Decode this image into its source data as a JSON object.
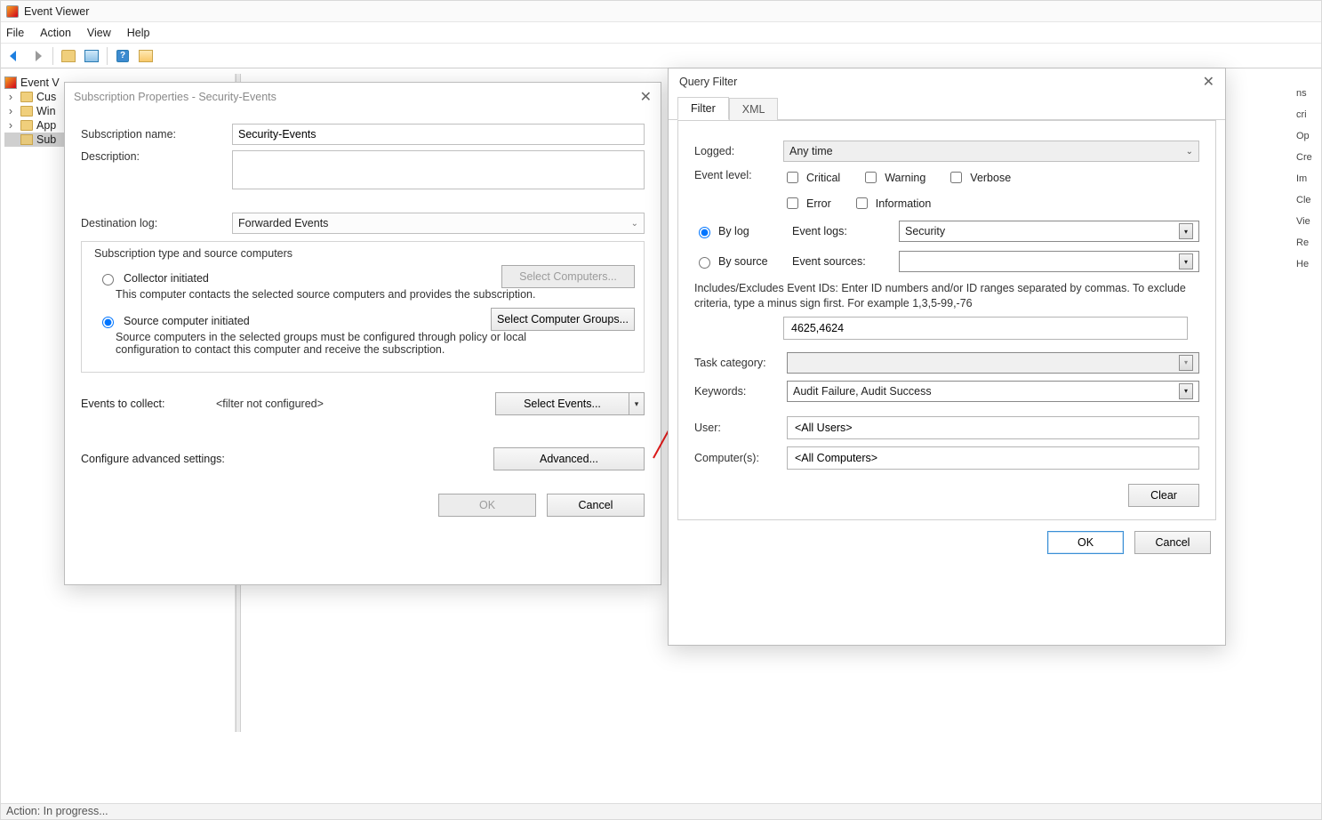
{
  "app": {
    "title": "Event Viewer"
  },
  "menu": {
    "file": "File",
    "action": "Action",
    "view": "View",
    "help": "Help"
  },
  "tree": {
    "root": "Event V",
    "items": [
      "Cus",
      "Win",
      "App",
      "Sub"
    ]
  },
  "status": "Action:  In progress...",
  "subProps": {
    "title": "Subscription Properties - Security-Events",
    "subNameLbl": "Subscription name:",
    "subName": "Security-Events",
    "descLbl": "Description:",
    "descVal": "",
    "destLogLbl": "Destination log:",
    "destLog": "Forwarded Events",
    "groupTitle": "Subscription type and source computers",
    "collectorLbl": "Collector initiated",
    "collectorHelp": "This computer contacts the selected source computers and provides the subscription.",
    "selectComputersBtn": "Select Computers...",
    "sourceLbl": "Source computer initiated",
    "sourceHelp": "Source computers in the selected groups must be configured through policy or local configuration to contact this computer and receive the subscription.",
    "selectGroupsBtn": "Select Computer Groups...",
    "eventsCollectLbl": "Events to collect:",
    "filterText": "<filter not configured>",
    "selectEventsBtn": "Select Events...",
    "cfgAdvLbl": "Configure advanced settings:",
    "advancedBtn": "Advanced...",
    "okBtn": "OK",
    "cancelBtn": "Cancel"
  },
  "qf": {
    "title": "Query Filter",
    "tabFilter": "Filter",
    "tabXml": "XML",
    "loggedLbl": "Logged:",
    "loggedVal": "Any time",
    "levelLbl": "Event level:",
    "lvCritical": "Critical",
    "lvWarning": "Warning",
    "lvVerbose": "Verbose",
    "lvError": "Error",
    "lvInfo": "Information",
    "byLog": "By log",
    "evLogsLbl": "Event logs:",
    "evLogsVal": "Security",
    "bySource": "By source",
    "evSrcLbl": "Event sources:",
    "evSrcVal": "",
    "idsHelp": "Includes/Excludes Event IDs: Enter ID numbers and/or ID ranges separated by commas. To exclude criteria, type a minus sign first. For example 1,3,5-99,-76",
    "idsVal": "4625,4624",
    "taskCatLbl": "Task category:",
    "taskCatVal": "",
    "kwLbl": "Keywords:",
    "kwVal": "Audit Failure, Audit Success",
    "userLbl": "User:",
    "userVal": "<All Users>",
    "compLbl": "Computer(s):",
    "compVal": "<All Computers>",
    "clearBtn": "Clear",
    "okBtn": "OK",
    "cancelBtn": "Cancel"
  },
  "peek": [
    "ns",
    "cri",
    "Op",
    "Cre",
    "Im",
    "Cle",
    "Vie",
    "Re",
    "He"
  ]
}
